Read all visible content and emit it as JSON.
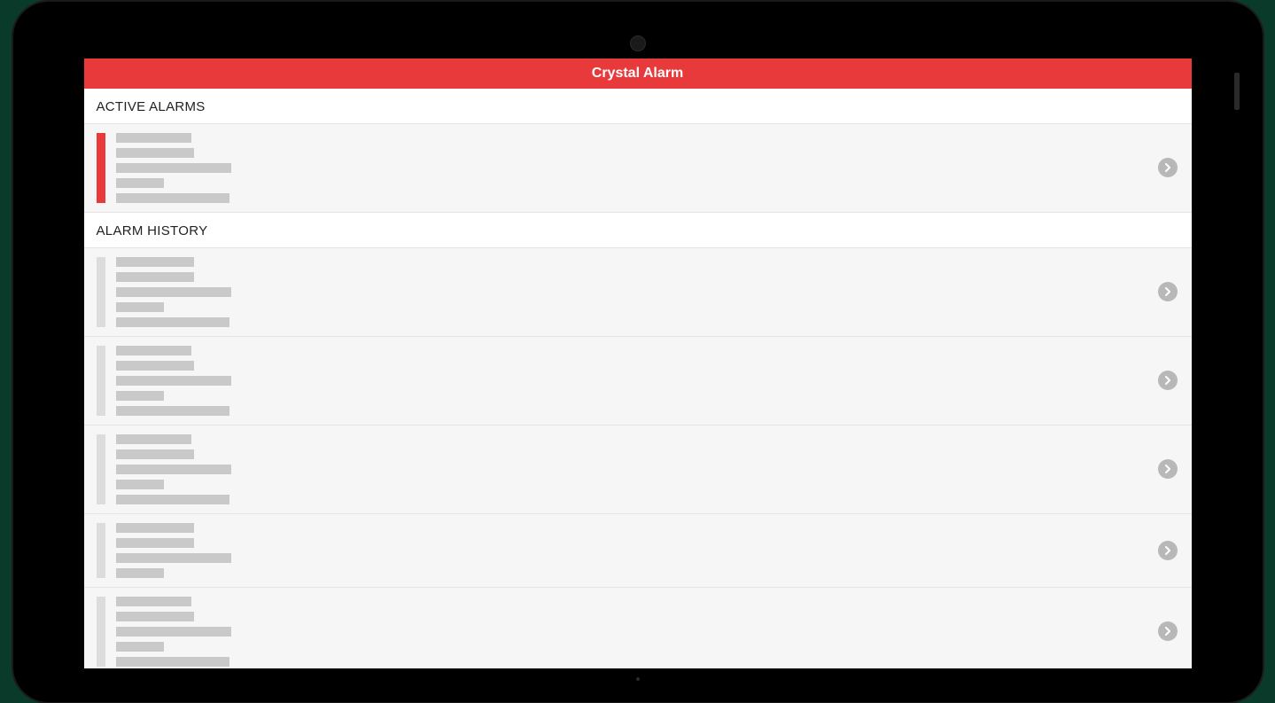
{
  "header": {
    "title": "Crystal Alarm"
  },
  "sections": {
    "active": {
      "label": "ACTIVE ALARMS"
    },
    "history": {
      "label": "ALARM HISTORY"
    }
  },
  "active_alarms": [
    {
      "status": "active"
    }
  ],
  "alarm_history": [
    {
      "status": "history"
    },
    {
      "status": "history"
    },
    {
      "status": "history"
    },
    {
      "status": "history"
    },
    {
      "status": "history"
    }
  ],
  "icons": {
    "chevron": "chevron-right-circle"
  },
  "colors": {
    "brand_red": "#e8393b",
    "row_bg": "#f6f6f6",
    "skeleton": "#c9c9c9",
    "history_bar": "#dcdcdc"
  }
}
